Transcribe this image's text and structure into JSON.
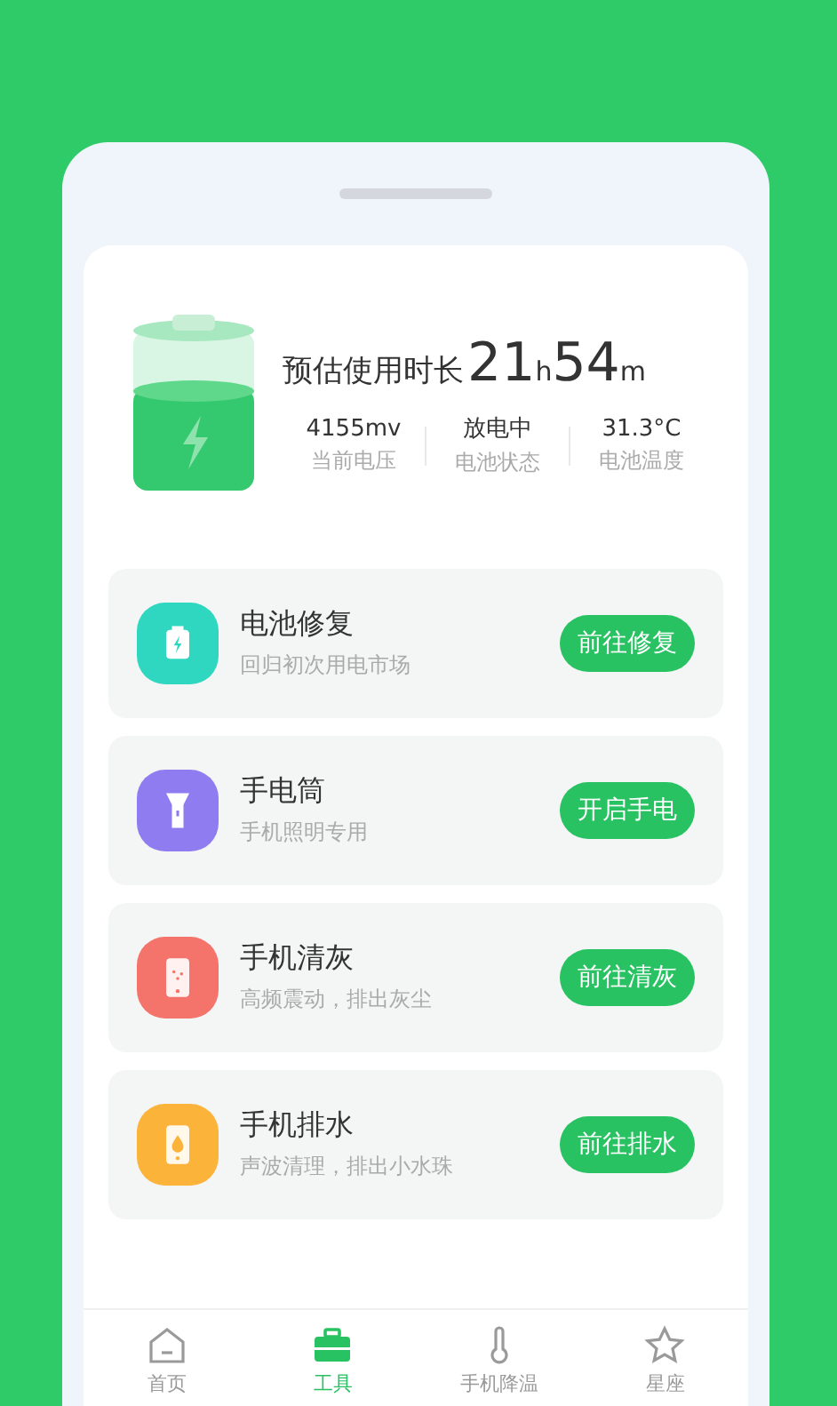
{
  "summary": {
    "label": "预估使用时长",
    "hours": "21",
    "hours_unit": "h",
    "minutes": "54",
    "minutes_unit": "m"
  },
  "stats": [
    {
      "value": "4155mv",
      "label": "当前电压"
    },
    {
      "value": "放电中",
      "label": "电池状态"
    },
    {
      "value": "31.3°C",
      "label": "电池温度"
    }
  ],
  "tools": [
    {
      "kind": "battery",
      "color": "#2fd6c0",
      "title": "电池修复",
      "subtitle": "回归初次用电市场",
      "button": "前往修复"
    },
    {
      "kind": "flashlight",
      "color": "#8f7cf0",
      "title": "手电筒",
      "subtitle": "手机照明专用",
      "button": "开启手电"
    },
    {
      "kind": "dust",
      "color": "#f4736a",
      "title": "手机清灰",
      "subtitle": "高频震动，排出灰尘",
      "button": "前往清灰"
    },
    {
      "kind": "water",
      "color": "#fbb33a",
      "title": "手机排水",
      "subtitle": "声波清理，排出小水珠",
      "button": "前往排水"
    }
  ],
  "nav": [
    {
      "kind": "home",
      "label": "首页",
      "selected": false
    },
    {
      "kind": "toolbox",
      "label": "工具",
      "selected": true
    },
    {
      "kind": "thermometer",
      "label": "手机降温",
      "selected": false
    },
    {
      "kind": "star",
      "label": "星座",
      "selected": false
    }
  ]
}
